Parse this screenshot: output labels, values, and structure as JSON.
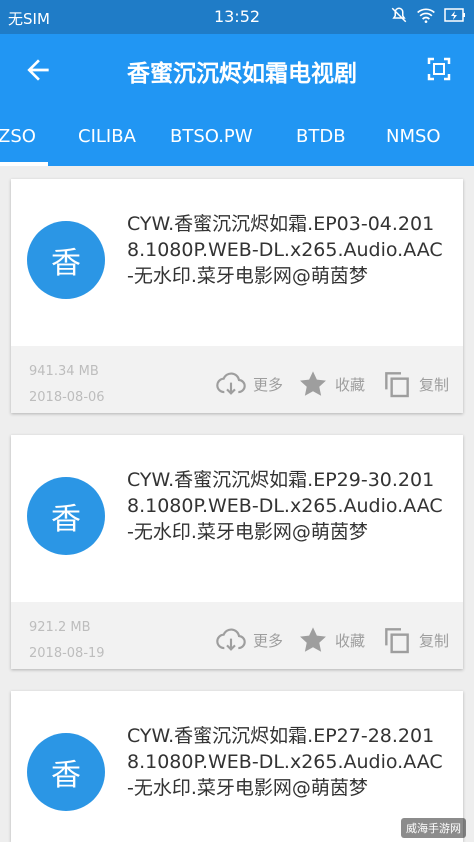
{
  "status_bar": {
    "carrier": "无SIM",
    "time": "13:52"
  },
  "app_bar": {
    "title": "香蜜沉沉烬如霜电视剧"
  },
  "tabs": [
    {
      "label": "ZSO"
    },
    {
      "label": "CILIBA"
    },
    {
      "label": "BTSO.PW"
    },
    {
      "label": "BTDB"
    },
    {
      "label": "NMSO"
    }
  ],
  "results": [
    {
      "avatar": "香",
      "name": "CYW.香蜜沉沉烬如霜.EP03-04.2018.1080P.WEB-DL.x265.Audio.AAC-无水印.菜牙电影网@萌茵梦",
      "size": "941.34 MB",
      "date": "2018-08-06"
    },
    {
      "avatar": "香",
      "name": "CYW.香蜜沉沉烬如霜.EP29-30.2018.1080P.WEB-DL.x265.Audio.AAC-无水印.菜牙电影网@萌茵梦",
      "size": "921.2 MB",
      "date": "2018-08-19"
    },
    {
      "avatar": "香",
      "name": "CYW.香蜜沉沉烬如霜.EP27-28.2018.1080P.WEB-DL.x265.Audio.AAC-无水印.菜牙电影网@萌茵梦",
      "size": "",
      "date": ""
    }
  ],
  "actions": {
    "more": "更多",
    "favorite": "收藏",
    "copy": "复制"
  },
  "watermark": "威海手游网",
  "colors": {
    "primary": "#2196f3",
    "status_bar": "#1f7cc7",
    "avatar": "#2b96e5"
  }
}
